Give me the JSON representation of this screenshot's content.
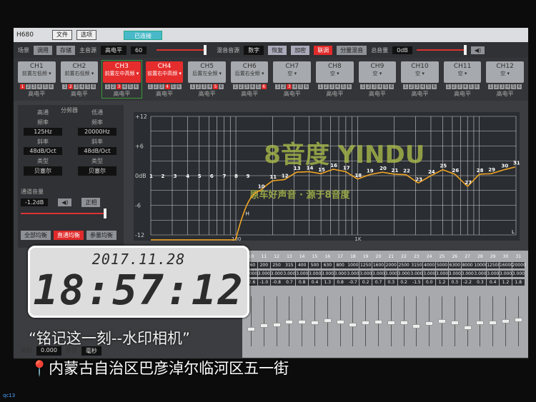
{
  "window": {
    "title": "H680",
    "menu": [
      "文件",
      "选项"
    ],
    "status": "已连接"
  },
  "toolbar": {
    "scene_label": "场景",
    "recall": "调用",
    "save": "存储",
    "main_source_label": "主音源",
    "main_source": "高电平",
    "main_value": "60",
    "mix_source_label": "混音音源",
    "mix_source": "数字",
    "buttons": [
      "恢复",
      "加密",
      "联调",
      "分量混音"
    ],
    "active_button": "联调",
    "total_volume_label": "总音量",
    "total_volume": "0dB"
  },
  "channels": [
    {
      "id": "CH1",
      "name": "前置左低频",
      "out": 1,
      "level": "高电平"
    },
    {
      "id": "CH2",
      "name": "前置右低频",
      "out": 2,
      "level": "高电平"
    },
    {
      "id": "CH3",
      "name": "前置左中高频",
      "out": 3,
      "level": "高电平",
      "selected": true
    },
    {
      "id": "CH4",
      "name": "前置右中高频",
      "out": 4,
      "level": "高电平"
    },
    {
      "id": "CH5",
      "name": "后置左全频",
      "out": 5,
      "level": "高电平"
    },
    {
      "id": "CH6",
      "name": "后置右全频",
      "out": 6,
      "level": "高电平"
    },
    {
      "id": "CH7",
      "name": "空",
      "out": 3,
      "level": "高电平"
    },
    {
      "id": "CH8",
      "name": "空",
      "out": 0,
      "level": "高电平"
    },
    {
      "id": "CH9",
      "name": "空",
      "out": 0,
      "level": "高电平"
    },
    {
      "id": "CH10",
      "name": "空",
      "out": 0,
      "level": "高电平"
    },
    {
      "id": "CH11",
      "name": "空",
      "out": 0,
      "level": "高电平"
    },
    {
      "id": "CH12",
      "name": "空",
      "out": 0,
      "level": "高电平"
    }
  ],
  "crossover": {
    "title": "分频器",
    "highpass": {
      "label": "高通",
      "freq_label": "频率",
      "freq": "125Hz",
      "slope_label": "斜率",
      "slope": "48dB/Oct",
      "type_label": "类型",
      "type": "贝塞尔"
    },
    "lowpass": {
      "label": "低通",
      "freq_label": "频率",
      "freq": "20000Hz",
      "slope_label": "斜率",
      "slope": "48dB/Oct",
      "type_label": "类型",
      "type": "贝塞尔"
    }
  },
  "channel_volume": {
    "label": "通道音量",
    "value": "-1.2dB",
    "phase": "正相"
  },
  "eq_modes": [
    "全部均衡",
    "直通均衡",
    "参量均衡"
  ],
  "active_eq_mode": "直通均衡",
  "delay": {
    "label": "延时",
    "value": "0.000",
    "unit_label": "单位",
    "unit": "毫秒"
  },
  "chart_data": {
    "type": "line",
    "y_ticks": [
      "+12",
      "+6",
      "0dB",
      "-6",
      "-12"
    ],
    "ylim": [
      -12,
      12
    ],
    "x_ticks": [
      "100",
      "1K"
    ],
    "xlim": [
      20,
      20000
    ],
    "x_scale": "log",
    "grid": true,
    "bands": {
      "index": [
        10,
        11,
        12,
        13,
        14,
        15,
        16,
        17,
        18,
        19,
        20,
        21,
        22,
        23,
        24,
        25,
        26,
        27,
        28,
        29,
        30,
        31
      ],
      "freq": [
        160,
        200,
        250,
        315,
        400,
        500,
        630,
        800,
        1000,
        1250,
        1600,
        2000,
        2500,
        3150,
        4000,
        5000,
        6300,
        8000,
        10000,
        12500,
        16000,
        20000
      ],
      "q": [
        "3.000",
        "3.000",
        "3.000",
        "3.000",
        "3.000",
        "3.000",
        "3.000",
        "3.000",
        "3.000",
        "3.000",
        "3.000",
        "3.000",
        "3.000",
        "3.000",
        "3.000",
        "3.000",
        "3.000",
        "3.000",
        "3.000",
        "3.000",
        "3.000",
        "3.000"
      ],
      "gain": [
        -2.6,
        -1.0,
        -0.8,
        0.7,
        0.8,
        0.4,
        1.3,
        0.8,
        -0.7,
        0.2,
        0.7,
        0.3,
        0.2,
        -1.5,
        0.0,
        1.2,
        0.3,
        -2.2,
        0.3,
        0.4,
        1.2,
        1.8
      ]
    },
    "markers": [
      "H",
      "L"
    ],
    "level_percent": 52
  },
  "watermark": {
    "date": "2017.11.28",
    "time": "18:57:12",
    "slogan": "“铭记这一刻--水印相机”",
    "location": "内蒙古自治区巴彦淖尔临河区五一街",
    "logo_text": "8音度 YINDU",
    "logo_slogan": "原车好声音 · 源于8音度",
    "tag": "qc13"
  }
}
